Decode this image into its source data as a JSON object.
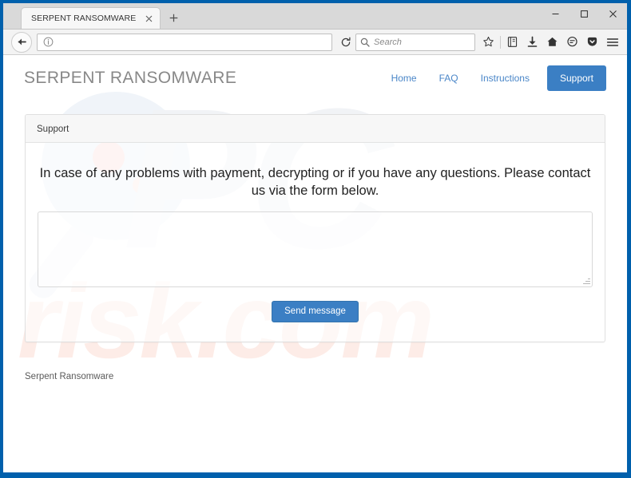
{
  "browser": {
    "tab": {
      "title": "SERPENT RANSOMWARE",
      "close_icon": "close-icon",
      "newtab_icon": "plus-icon"
    },
    "window_controls": {
      "minimize": "minimize-icon",
      "maximize": "maximize-icon",
      "close": "close-icon"
    },
    "toolbar": {
      "back_icon": "back-arrow-icon",
      "reload_icon": "reload-icon",
      "identity_icon": "info-icon",
      "url_value": "",
      "url_placeholder": "",
      "search_placeholder": "Search",
      "search_value": "",
      "search_icon": "search-icon",
      "icons": [
        {
          "name": "star-icon",
          "label": "Bookmark this page"
        },
        {
          "name": "library-icon",
          "label": "Show your library"
        },
        {
          "name": "download-icon",
          "label": "Downloads"
        },
        {
          "name": "home-icon",
          "label": "Home"
        },
        {
          "name": "sync-icon",
          "label": "Synced tabs"
        },
        {
          "name": "pocket-icon",
          "label": "Save to Pocket"
        },
        {
          "name": "menu-icon",
          "label": "Open menu"
        }
      ]
    }
  },
  "site": {
    "brand": "SERPENT RANSOMWARE",
    "nav_links": [
      {
        "label": "Home",
        "active": false
      },
      {
        "label": "FAQ",
        "active": false
      },
      {
        "label": "Instructions",
        "active": false
      },
      {
        "label": "Support",
        "active": true
      }
    ],
    "panel": {
      "title": "Support",
      "lead": "In case of any problems with payment, decrypting or if you have any questions. Please contact us via the form below.",
      "message_value": "",
      "message_placeholder": "",
      "send_button": "Send message"
    },
    "footer": {
      "text": "Serpent Ransomware"
    },
    "watermark": {
      "logo": "PC",
      "domain": "risk.com"
    },
    "colors": {
      "accent": "#3b7fc4",
      "link": "#4a86c8",
      "brand_text": "#888888",
      "panel_header_bg": "#f7f7f7",
      "frame": "#0060ac"
    }
  }
}
